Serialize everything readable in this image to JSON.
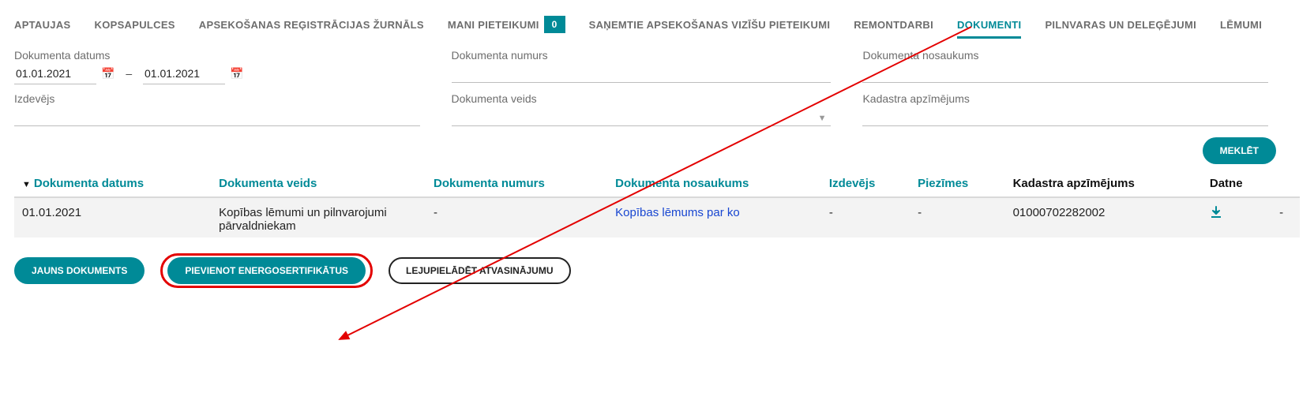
{
  "nav": {
    "items": [
      {
        "label": "Aptaujas"
      },
      {
        "label": "Kopsapulces"
      },
      {
        "label": "Apsekošanas reģistrācijas žurnāls"
      },
      {
        "label": "Mani pieteikumi",
        "badge": "0"
      },
      {
        "label": "Saņemtie apsekošanas vizīšu pieteikumi"
      },
      {
        "label": "Remontdarbi"
      },
      {
        "label": "Dokumenti",
        "active": true
      },
      {
        "label": "Pilnvaras un deleģējumi"
      },
      {
        "label": "Lēmumi"
      }
    ]
  },
  "filters": {
    "date_label": "Dokumenta datums",
    "date_from": "01.01.2021",
    "date_to": "01.01.2021",
    "number_label": "Dokumenta numurs",
    "name_label": "Dokumenta nosaukums",
    "issuer_label": "Izdevējs",
    "type_label": "Dokumenta veids",
    "cadastre_label": "Kadastra apzīmējums",
    "search_btn": "Meklēt"
  },
  "table": {
    "headers": {
      "date": "Dokumenta datums",
      "type": "Dokumenta veids",
      "number": "Dokumenta numurs",
      "name": "Dokumenta nosaukums",
      "issuer": "Izdevējs",
      "notes": "Piezīmes",
      "cadastre": "Kadastra apzīmējums",
      "file": "Datne"
    },
    "rows": [
      {
        "date": "01.01.2021",
        "type": "Kopības lēmumi un pilnvarojumi pārvaldniekam",
        "number": "-",
        "name": "Kopības lēmums par ko",
        "issuer": "-",
        "notes": "-",
        "cadastre": "01000702282002",
        "extra": "-"
      }
    ]
  },
  "buttons": {
    "new_doc": "Jauns dokuments",
    "add_cert": "Pievienot energosertifikātus",
    "download": "Lejupielādēt atvasinājumu"
  }
}
